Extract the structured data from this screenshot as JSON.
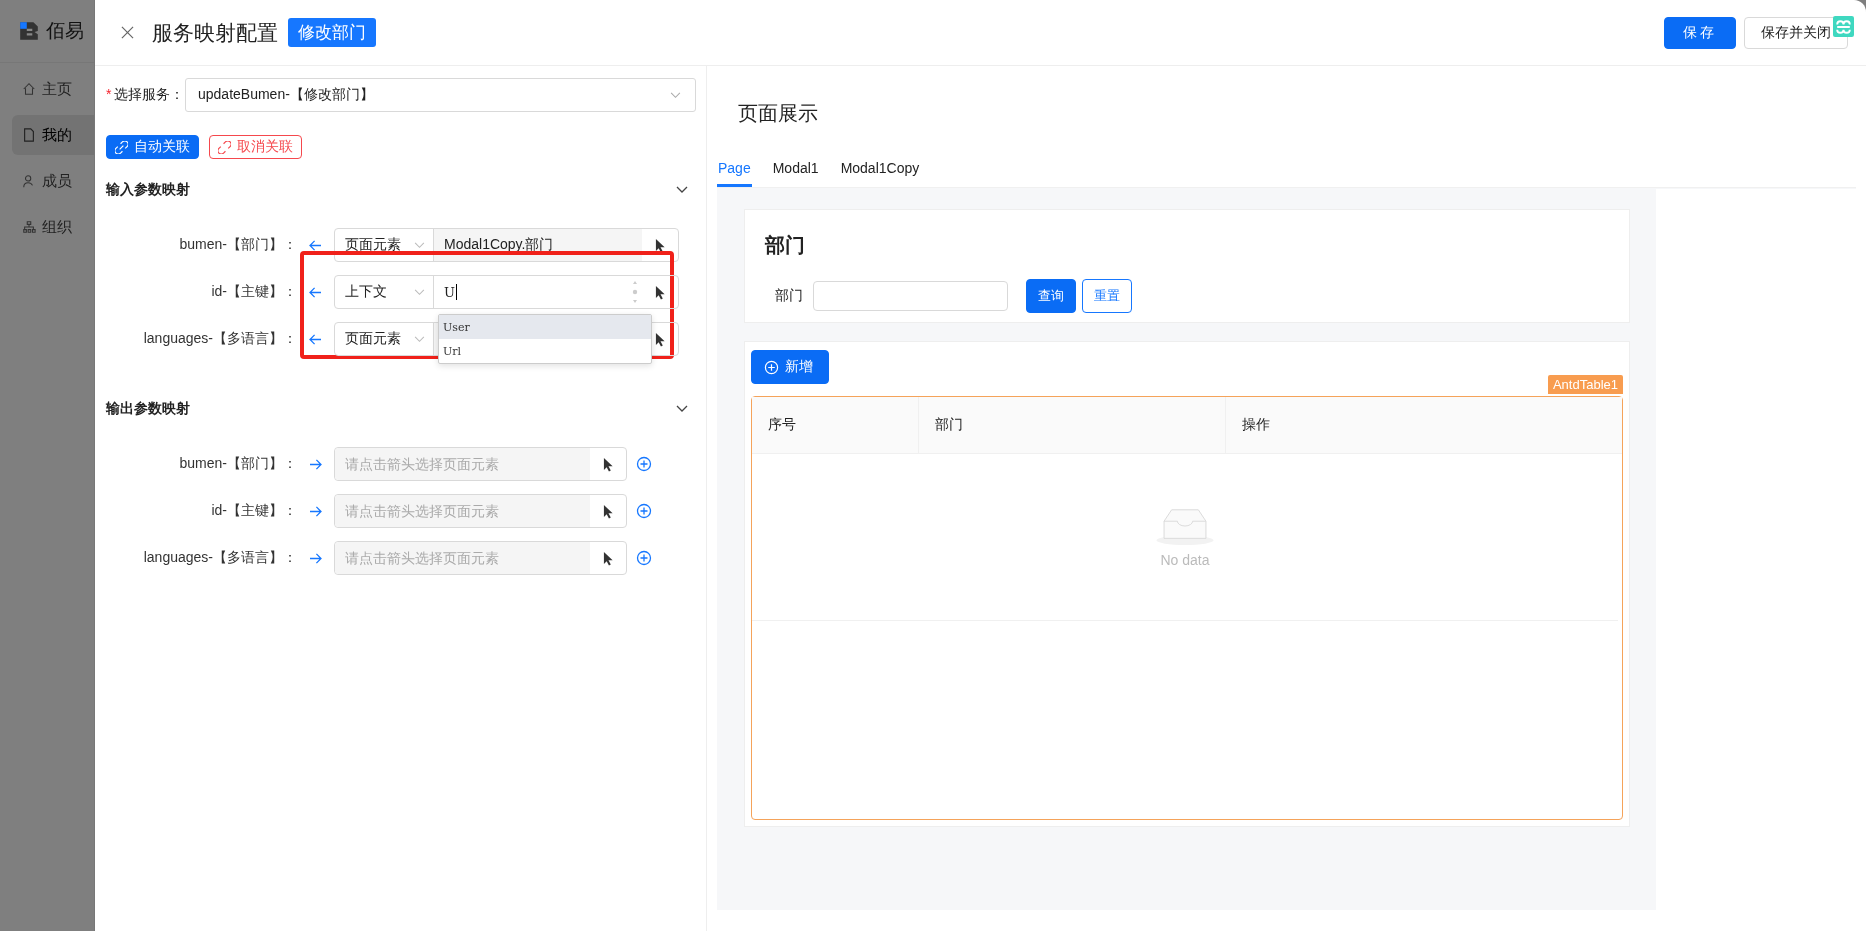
{
  "app_sidebar": {
    "logo_text": "佰易",
    "items": [
      {
        "label": "主页",
        "selected": false
      },
      {
        "label": "我的",
        "selected": true
      },
      {
        "label": "成员",
        "selected": false
      },
      {
        "label": "组织",
        "selected": false
      }
    ]
  },
  "drawer": {
    "title": "服务映射配置",
    "tag": "修改部门",
    "buttons": [
      {
        "label": "保存",
        "kind": "primary"
      },
      {
        "label": "保存并关闭",
        "kind": "default"
      }
    ]
  },
  "service": {
    "label": "选择服务：",
    "required_mark": "*",
    "value": "updateBumen-【修改部门】"
  },
  "link_buttons": [
    {
      "label": "自动关联",
      "kind": "primary"
    },
    {
      "label": "取消关联",
      "kind": "danger"
    }
  ],
  "input_mapping": {
    "title": "输入参数映射",
    "expanded": true,
    "rows": [
      {
        "label": "bumen-【部门】：",
        "source": "页面元素",
        "value": "Modal1Copy.部门",
        "annotated": false
      },
      {
        "label": "id-【主键】：",
        "source": "上下文",
        "value": "U",
        "annotated": true,
        "suggestions": [
          {
            "label": "User",
            "selected": true
          },
          {
            "label": "Url",
            "selected": false
          }
        ]
      },
      {
        "label": "languages-【多语言】：",
        "source": "页面元素",
        "annotated": false
      }
    ]
  },
  "output_mapping": {
    "title": "输出参数映射",
    "expanded": true,
    "rows": [
      {
        "label": "bumen-【部门】：",
        "placeholder": "请点击箭头选择页面元素"
      },
      {
        "label": "id-【主键】：",
        "placeholder": "请点击箭头选择页面元素"
      },
      {
        "label": "languages-【多语言】：",
        "placeholder": "请点击箭头选择页面元素"
      }
    ]
  },
  "preview": {
    "title": "页面展示",
    "tabs": [
      {
        "label": "Page",
        "selected": true
      },
      {
        "label": "Modal1",
        "selected": false
      },
      {
        "label": "Modal1Copy",
        "selected": false
      }
    ],
    "search_card": {
      "title": "部门",
      "field_label": "部门",
      "buttons": [
        {
          "label": "查询",
          "kind": "primary"
        },
        {
          "label": "重置",
          "kind": "default"
        }
      ]
    },
    "table_card": {
      "add_button": "新增",
      "component_tag": "AntdTable1",
      "columns": [
        "序号",
        "部门",
        "操作"
      ],
      "empty_text": "No data"
    }
  }
}
